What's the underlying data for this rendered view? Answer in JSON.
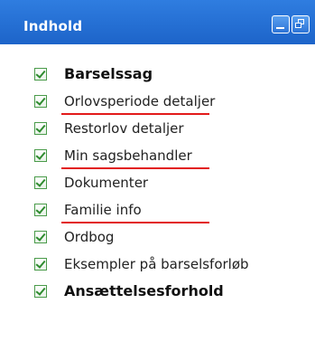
{
  "header": {
    "title": "Indhold",
    "minimize_icon": "minimize-icon",
    "restore_icon": "restore-icon"
  },
  "items": [
    {
      "label": "Barselssag",
      "bold": true,
      "checked": true,
      "underlined": false
    },
    {
      "label": "Orlovsperiode detaljer",
      "bold": false,
      "checked": true,
      "underlined": true
    },
    {
      "label": "Restorlov detaljer",
      "bold": false,
      "checked": true,
      "underlined": false
    },
    {
      "label": "Min sagsbehandler",
      "bold": false,
      "checked": true,
      "underlined": true
    },
    {
      "label": "Dokumenter",
      "bold": false,
      "checked": true,
      "underlined": false
    },
    {
      "label": "Familie info",
      "bold": false,
      "checked": true,
      "underlined": true
    },
    {
      "label": "Ordbog",
      "bold": false,
      "checked": true,
      "underlined": false
    },
    {
      "label": "Eksempler på barselsforløb",
      "bold": false,
      "checked": true,
      "underlined": false
    },
    {
      "label": "Ansættelsesforhold",
      "bold": true,
      "checked": true,
      "underlined": false
    }
  ],
  "colors": {
    "header_blue": "#1d64c9",
    "underline_red": "#e21b1b",
    "check_green": "#2e8b2e"
  }
}
